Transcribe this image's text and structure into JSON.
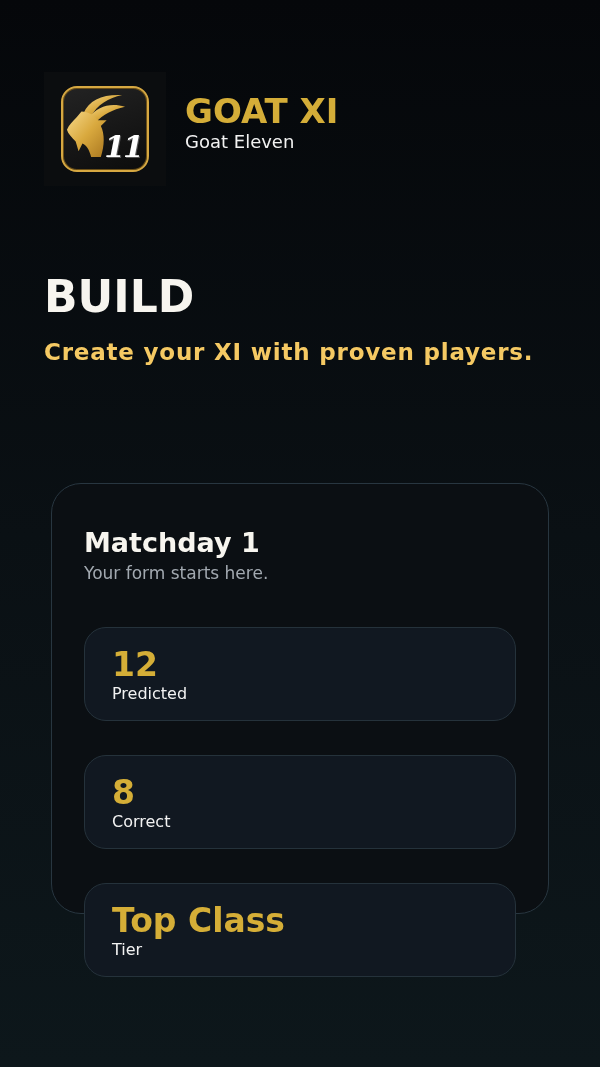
{
  "app": {
    "name": "GOAT XI",
    "tagline": "Goat Eleven",
    "logo_badge": "11"
  },
  "hero": {
    "title": "BUILD",
    "subtitle": "Create your XI with proven players."
  },
  "summary_card": {
    "title": "Matchday 1",
    "description": "Your form starts here.",
    "stats": [
      {
        "value": "12",
        "label": "Predicted"
      },
      {
        "value": "8",
        "label": "Correct"
      },
      {
        "value": "Top Class",
        "label": "Tier"
      }
    ]
  }
}
